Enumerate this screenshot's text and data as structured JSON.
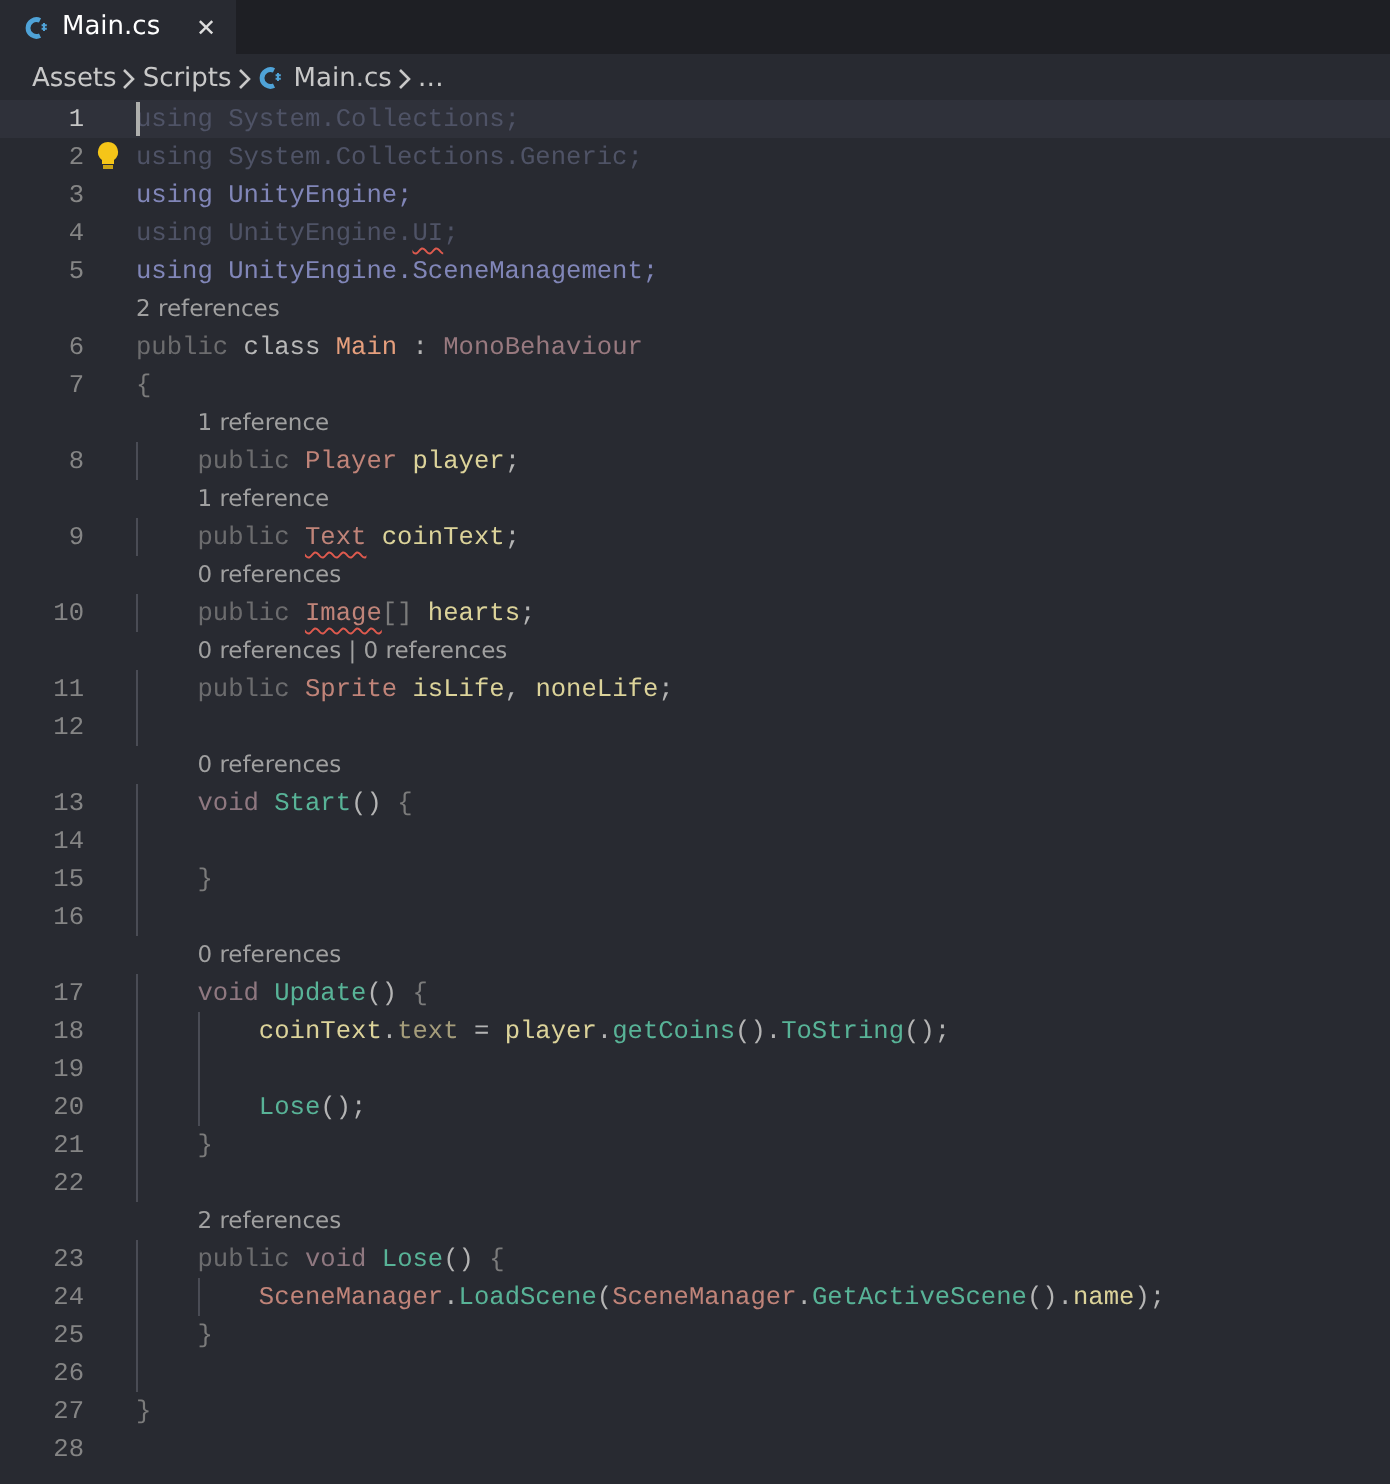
{
  "tab": {
    "label": "Main.cs",
    "close": "✕",
    "selected": true
  },
  "breadcrumb": [
    {
      "label": "Assets",
      "kind": "folder"
    },
    {
      "label": "Scripts",
      "kind": "folder"
    },
    {
      "label": "Main.cs",
      "kind": "file"
    },
    {
      "label": "…",
      "kind": "more"
    }
  ],
  "lines": [
    {
      "number": "1",
      "current": true,
      "tokens": [
        {
          "text": "using System.Collections;",
          "kind": "faded"
        }
      ]
    },
    {
      "number": "2",
      "current": false,
      "tokens": [
        {
          "text": "using System.Collections.Generic;",
          "kind": "faded"
        }
      ]
    },
    {
      "number": "3",
      "current": false,
      "tokens": [
        {
          "text": "using UnityEngine;",
          "kind": "ns"
        }
      ]
    },
    {
      "number": "4",
      "current": false,
      "tokens": [
        {
          "text": "using UnityEngine.",
          "kind": "faded"
        },
        {
          "text": "UI",
          "kind": "faded_err"
        },
        {
          "text": ";",
          "kind": "faded"
        }
      ]
    },
    {
      "number": "5",
      "current": false,
      "tokens": [
        {
          "text": "using UnityEngine.SceneManagement;",
          "kind": "ns"
        }
      ]
    },
    {
      "number": "6",
      "current": false,
      "lens": "2 references",
      "tokens": [
        {
          "text": "public ",
          "kind": "mod"
        },
        {
          "text": "class ",
          "kind": "class"
        },
        {
          "text": "Main",
          "kind": "classname"
        },
        {
          "text": " : ",
          "kind": "punct"
        },
        {
          "text": "MonoBehaviour",
          "kind": "base"
        }
      ]
    },
    {
      "number": "7",
      "current": false,
      "tokens": [
        {
          "text": "{",
          "kind": "dim"
        }
      ]
    },
    {
      "number": "8",
      "current": false,
      "lens": "1 reference",
      "tokens": [
        {
          "text": "    public ",
          "kind": "mod"
        },
        {
          "text": "Player",
          "kind": "type"
        },
        {
          "text": " player",
          "kind": "field"
        },
        {
          "text": ";",
          "kind": "punct"
        }
      ]
    },
    {
      "number": "9",
      "current": false,
      "lens": "1 reference",
      "tokens": [
        {
          "text": "    public ",
          "kind": "mod"
        },
        {
          "text": "Text",
          "kind": "type_err"
        },
        {
          "text": " coinText",
          "kind": "field"
        },
        {
          "text": ";",
          "kind": "punct"
        }
      ]
    },
    {
      "number": "10",
      "current": false,
      "lens": "0 references",
      "tokens": [
        {
          "text": "    public ",
          "kind": "mod"
        },
        {
          "text": "Image",
          "kind": "type_err"
        },
        {
          "text": "[]",
          "kind": "dim"
        },
        {
          "text": " hearts",
          "kind": "field"
        },
        {
          "text": ";",
          "kind": "punct"
        }
      ]
    },
    {
      "number": "11",
      "current": false,
      "lens": "0 references | 0 references",
      "tokens": [
        {
          "text": "    public ",
          "kind": "mod"
        },
        {
          "text": "Sprite",
          "kind": "type"
        },
        {
          "text": " isLife",
          "kind": "field"
        },
        {
          "text": ", ",
          "kind": "punct"
        },
        {
          "text": "noneLife",
          "kind": "field"
        },
        {
          "text": ";",
          "kind": "punct"
        }
      ]
    },
    {
      "number": "12",
      "current": false
    },
    {
      "number": "13",
      "current": false,
      "lens": "0 references",
      "tokens": [
        {
          "text": "    void ",
          "kind": "kw"
        },
        {
          "text": "Start",
          "kind": "method"
        },
        {
          "text": "() ",
          "kind": "punct"
        },
        {
          "text": "{",
          "kind": "dim"
        }
      ]
    },
    {
      "number": "14",
      "current": false
    },
    {
      "number": "15",
      "current": false,
      "tokens": [
        {
          "text": "    }",
          "kind": "dim"
        }
      ]
    },
    {
      "number": "16",
      "current": false
    },
    {
      "number": "17",
      "current": false,
      "lens": "0 references",
      "tokens": [
        {
          "text": "    void ",
          "kind": "kw"
        },
        {
          "text": "Update",
          "kind": "method"
        },
        {
          "text": "() ",
          "kind": "punct"
        },
        {
          "text": "{",
          "kind": "dim"
        }
      ]
    },
    {
      "number": "18",
      "current": false,
      "tokens": [
        {
          "text": "        coinText",
          "kind": "field"
        },
        {
          "text": ".",
          "kind": "punct"
        },
        {
          "text": "text",
          "kind": "prop"
        },
        {
          "text": " = ",
          "kind": "punct"
        },
        {
          "text": "player",
          "kind": "field"
        },
        {
          "text": ".",
          "kind": "punct"
        },
        {
          "text": "getCoins",
          "kind": "method"
        },
        {
          "text": "().",
          "kind": "punct"
        },
        {
          "text": "ToString",
          "kind": "method"
        },
        {
          "text": "();",
          "kind": "punct"
        }
      ]
    },
    {
      "number": "19",
      "current": false
    },
    {
      "number": "20",
      "current": false,
      "tokens": [
        {
          "text": "        Lose",
          "kind": "method"
        },
        {
          "text": "();",
          "kind": "punct"
        }
      ]
    },
    {
      "number": "21",
      "current": false,
      "tokens": [
        {
          "text": "    }",
          "kind": "dim"
        }
      ]
    },
    {
      "number": "22",
      "current": false
    },
    {
      "number": "23",
      "current": false,
      "lens": "2 references",
      "tokens": [
        {
          "text": "    public ",
          "kind": "mod"
        },
        {
          "text": "void ",
          "kind": "kw"
        },
        {
          "text": "Lose",
          "kind": "method"
        },
        {
          "text": "() ",
          "kind": "punct"
        },
        {
          "text": "{",
          "kind": "dim"
        }
      ]
    },
    {
      "number": "24",
      "current": false,
      "tokens": [
        {
          "text": "        SceneManager",
          "kind": "type"
        },
        {
          "text": ".",
          "kind": "punct"
        },
        {
          "text": "LoadScene",
          "kind": "method"
        },
        {
          "text": "(",
          "kind": "punct"
        },
        {
          "text": "SceneManager",
          "kind": "type"
        },
        {
          "text": ".",
          "kind": "punct"
        },
        {
          "text": "GetActiveScene",
          "kind": "method"
        },
        {
          "text": "().",
          "kind": "punct"
        },
        {
          "text": "name",
          "kind": "field"
        },
        {
          "text": ");",
          "kind": "punct"
        }
      ]
    },
    {
      "number": "25",
      "current": false,
      "tokens": [
        {
          "text": "    }",
          "kind": "dim"
        }
      ]
    },
    {
      "number": "26",
      "current": false
    },
    {
      "number": "27",
      "current": false,
      "tokens": [
        {
          "text": "}",
          "kind": "dim"
        }
      ]
    },
    {
      "number": "28",
      "current": false
    }
  ]
}
